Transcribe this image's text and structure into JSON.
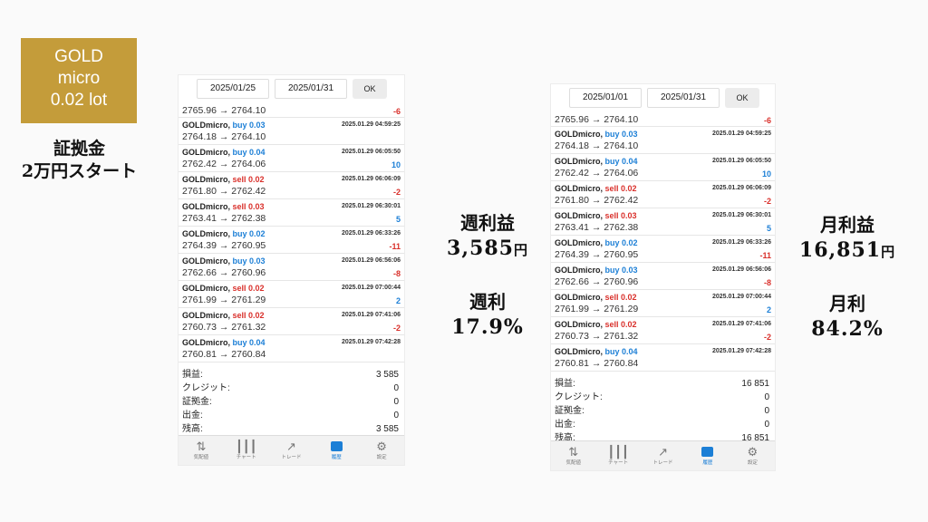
{
  "badge": {
    "line1": "GOLD",
    "line2": "micro",
    "line3": "0.02 lot"
  },
  "left_caption": {
    "line1": "証拠金",
    "line2": "2万円スタート"
  },
  "weekly": {
    "profit_title": "週利益",
    "profit_value": "3,585",
    "profit_unit": "円",
    "rate_title": "週利",
    "rate_value": "17.9%"
  },
  "monthly": {
    "profit_title": "月利益",
    "profit_value": "16,851",
    "profit_unit": "円",
    "rate_title": "月利",
    "rate_value": "84.2%"
  },
  "weekly_app": {
    "date_from": "2025/01/25",
    "date_to": "2025/01/31",
    "ok": "OK",
    "summary": {
      "profit_label": "損益:",
      "profit": "3 585",
      "credit_label": "クレジット:",
      "credit": "0",
      "margin_label": "証拠金:",
      "margin": "0",
      "withdraw_label": "出金:",
      "withdraw": "0",
      "balance_label": "残高:",
      "balance": "3 585"
    }
  },
  "monthly_app": {
    "date_from": "2025/01/01",
    "date_to": "2025/01/31",
    "ok": "OK",
    "summary": {
      "profit_label": "損益:",
      "profit": "16 851",
      "credit_label": "クレジット:",
      "credit": "0",
      "margin_label": "証拠金:",
      "margin": "0",
      "withdraw_label": "出金:",
      "withdraw": "0",
      "balance_label": "残高:",
      "balance": "16 851"
    }
  },
  "trades": [
    {
      "symbol": "",
      "side": "",
      "side_type": "buy",
      "time": "",
      "prices": "2765.96 → 2764.10",
      "pl": "-6",
      "pl_type": "neg",
      "partial": true
    },
    {
      "symbol": "GOLDmicro,",
      "side": "buy 0.03",
      "side_type": "buy",
      "time": "2025.01.29 04:59:25",
      "prices": "2764.18 → 2764.10",
      "pl": "",
      "pl_type": "neg"
    },
    {
      "symbol": "GOLDmicro,",
      "side": "buy 0.04",
      "side_type": "buy",
      "time": "2025.01.29 06:05:50",
      "prices": "2762.42 → 2764.06",
      "pl": "10",
      "pl_type": "pos"
    },
    {
      "symbol": "GOLDmicro,",
      "side": "sell 0.02",
      "side_type": "sell",
      "time": "2025.01.29 06:06:09",
      "prices": "2761.80 → 2762.42",
      "pl": "-2",
      "pl_type": "neg"
    },
    {
      "symbol": "GOLDmicro,",
      "side": "sell 0.03",
      "side_type": "sell",
      "time": "2025.01.29 06:30:01",
      "prices": "2763.41 → 2762.38",
      "pl": "5",
      "pl_type": "pos"
    },
    {
      "symbol": "GOLDmicro,",
      "side": "buy 0.02",
      "side_type": "buy",
      "time": "2025.01.29 06:33:26",
      "prices": "2764.39 → 2760.95",
      "pl": "-11",
      "pl_type": "neg"
    },
    {
      "symbol": "GOLDmicro,",
      "side": "buy 0.03",
      "side_type": "buy",
      "time": "2025.01.29 06:56:06",
      "prices": "2762.66 → 2760.96",
      "pl": "-8",
      "pl_type": "neg"
    },
    {
      "symbol": "GOLDmicro,",
      "side": "sell 0.02",
      "side_type": "sell",
      "time": "2025.01.29 07:00:44",
      "prices": "2761.99 → 2761.29",
      "pl": "2",
      "pl_type": "pos"
    },
    {
      "symbol": "GOLDmicro,",
      "side": "sell 0.02",
      "side_type": "sell",
      "time": "2025.01.29 07:41:06",
      "prices": "2760.73 → 2761.32",
      "pl": "-2",
      "pl_type": "neg"
    },
    {
      "symbol": "GOLDmicro,",
      "side": "buy 0.04",
      "side_type": "buy",
      "time": "2025.01.29 07:42:28",
      "prices": "2760.81 → 2760.84",
      "pl": "",
      "pl_type": "neg"
    }
  ],
  "tabs": [
    {
      "label": "気配値",
      "icon": "quotes-icon",
      "glyph": "⇅",
      "active": false
    },
    {
      "label": "チャート",
      "icon": "chart-icon",
      "glyph": "┃┃┃",
      "active": false
    },
    {
      "label": "トレード",
      "icon": "trade-icon",
      "glyph": "↗",
      "active": false
    },
    {
      "label": "履歴",
      "icon": "history-icon",
      "glyph": "",
      "active": true
    },
    {
      "label": "設定",
      "icon": "settings-icon",
      "glyph": "⚙",
      "active": false
    }
  ],
  "colors": {
    "gold": "#c49c3a",
    "buy": "#1c7fd6",
    "sell": "#d9302b"
  }
}
